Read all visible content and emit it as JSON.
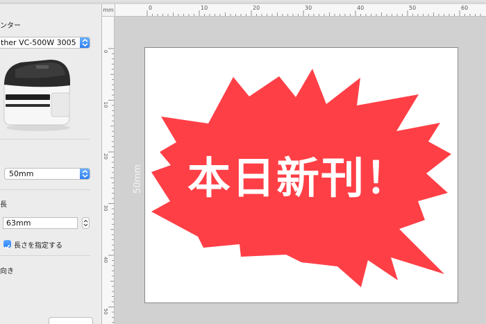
{
  "sidebar": {
    "printer_section_label": "ンター",
    "printer_select_value": "ther VC-500W 3005",
    "width_select_value": "50mm",
    "length_section_label": "長",
    "length_value": "63mm",
    "specify_length_checked": true,
    "specify_length_label": "長さを指定する",
    "orientation_label": "向き"
  },
  "ruler": {
    "unit": "mm",
    "top_ticks": [
      "0",
      "10",
      "20",
      "30",
      "40",
      "50",
      "60"
    ],
    "left_ticks": [
      "0",
      "10",
      "20",
      "30",
      "40",
      "50"
    ]
  },
  "canvas": {
    "height_label": "50mm",
    "burst_text": "本日新刊！",
    "burst_color": "#ff3f46"
  },
  "colors": {
    "accent_blue": "#2a7ef2",
    "burst_red": "#ff3f46"
  }
}
